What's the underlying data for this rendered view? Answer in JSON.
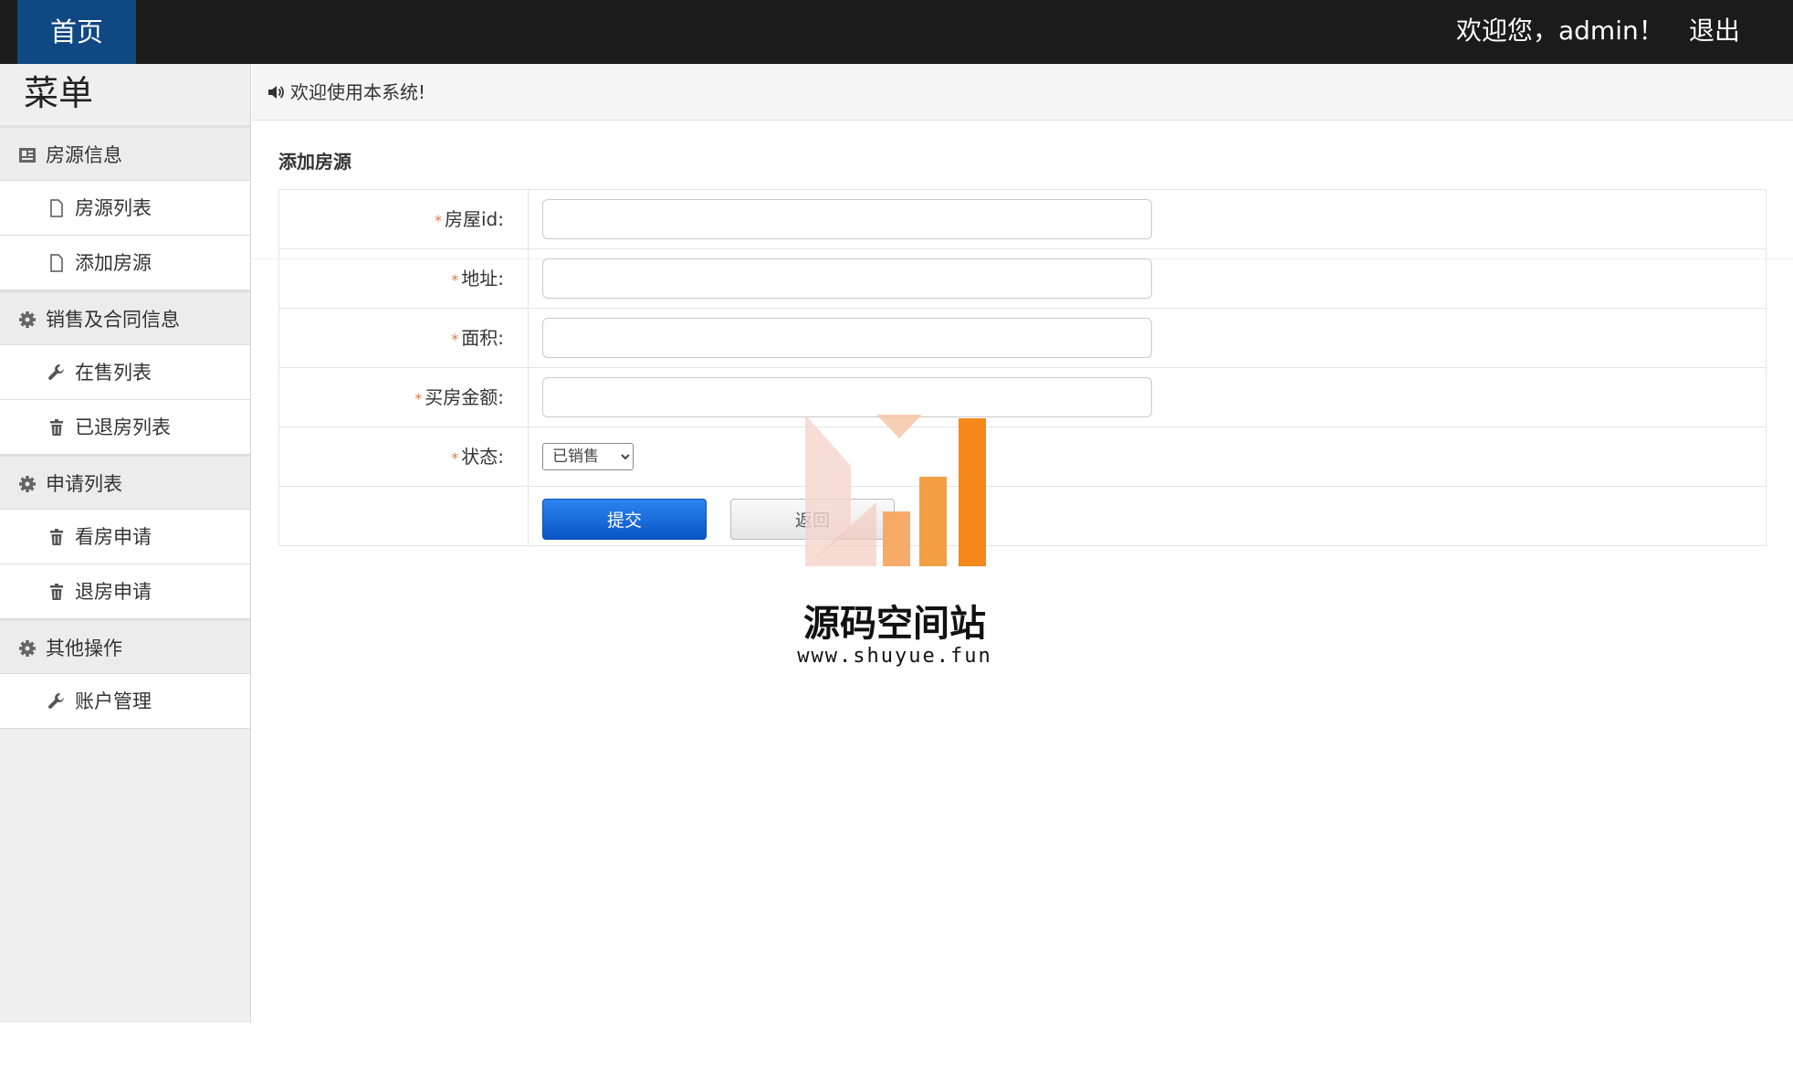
{
  "topbar": {
    "home_label": "首页",
    "welcome_text": "欢迎您，admin！",
    "logout_label": "退出"
  },
  "sidebar": {
    "title": "菜单",
    "groups": [
      {
        "label": "房源信息",
        "icon": "id-card-icon",
        "items": [
          {
            "label": "房源列表",
            "icon": "file-icon"
          },
          {
            "label": "添加房源",
            "icon": "file-icon"
          }
        ]
      },
      {
        "label": "销售及合同信息",
        "icon": "gear-icon",
        "items": [
          {
            "label": "在售列表",
            "icon": "wrench-icon"
          },
          {
            "label": "已退房列表",
            "icon": "trash-icon"
          }
        ]
      },
      {
        "label": "申请列表",
        "icon": "gear-icon",
        "items": [
          {
            "label": "看房申请",
            "icon": "trash-icon"
          },
          {
            "label": "退房申请",
            "icon": "trash-icon"
          }
        ]
      },
      {
        "label": "其他操作",
        "icon": "gear-icon",
        "items": [
          {
            "label": "账户管理",
            "icon": "wrench-icon"
          }
        ]
      }
    ]
  },
  "notice": {
    "text": "欢迎使用本系统!",
    "icon": "speaker-icon"
  },
  "form": {
    "title": "添加房源",
    "required_mark": "*",
    "fields": {
      "house_id": {
        "label": "房屋id:",
        "value": ""
      },
      "address": {
        "label": "地址:",
        "value": ""
      },
      "area": {
        "label": "面积:",
        "value": ""
      },
      "price": {
        "label": "买房金额:",
        "value": ""
      },
      "status": {
        "label": "状态:",
        "selected": "已销售"
      }
    },
    "submit_label": "提交",
    "back_label": "返回"
  },
  "watermark": {
    "name": "源码空间站",
    "url": "www.shuyue.fun"
  },
  "colors": {
    "topbar": "#1b1b1b",
    "home_tab": "#0f4883",
    "primary_button": "#0a55c8",
    "required": "#e07a4a"
  }
}
